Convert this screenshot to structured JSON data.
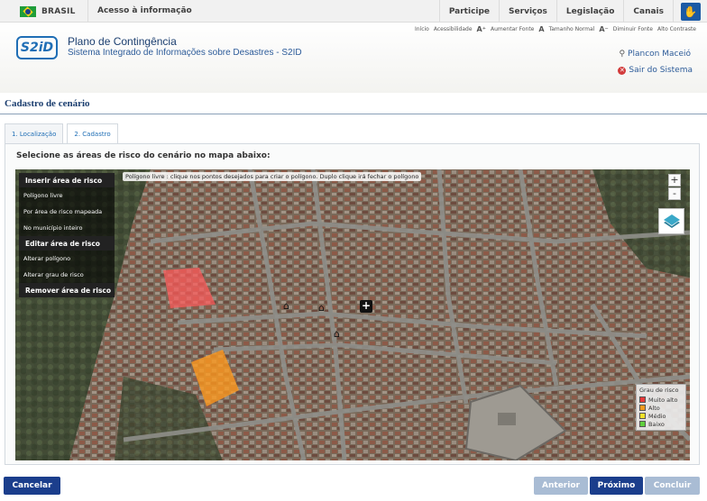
{
  "gov_bar": {
    "brasil": "BRASIL",
    "info": "Acesso à informação",
    "links": [
      "Participe",
      "Serviços",
      "Legislação",
      "Canais"
    ]
  },
  "header": {
    "logo": "S2iD",
    "title": "Plano de Contingência",
    "subtitle": "Sistema Integrado de Informações sobre Desastres - S2ID",
    "access_links": {
      "inicio": "Início",
      "acessibilidade": "Acessibilidade",
      "aumentar": "Aumentar Fonte",
      "normal": "Tamanho Normal",
      "diminuir": "Diminuir Fonte",
      "contraste": "Alto Contraste"
    },
    "user": "Plancon Maceió",
    "logout": "Sair do Sistema"
  },
  "page": {
    "heading": "Cadastro de cenário",
    "tabs": [
      {
        "label": "1. Localização",
        "active": false
      },
      {
        "label": "2. Cadastro",
        "active": true
      }
    ],
    "instruction": "Selecione as áreas de risco do cenário no mapa abaixo:"
  },
  "map": {
    "hint": "Polígono livre : clique nos pontos desejados para criar o polígono. Duplo clique irá fechar o polígono",
    "zoom_in": "+",
    "zoom_out": "-",
    "menu": {
      "insert_header": "Inserir área de risco",
      "insert_items": [
        "Polígono livre",
        "Por área de risco mapeada",
        "No município inteiro"
      ],
      "edit_header": "Editar área de risco",
      "edit_items": [
        "Alterar polígono",
        "Alterar grau de risco"
      ],
      "remove_header": "Remover área de risco"
    },
    "legend": {
      "title": "Grau de risco",
      "items": [
        {
          "label": "Muito alto",
          "color": "#e83a3a"
        },
        {
          "label": "Alto",
          "color": "#f39a1e"
        },
        {
          "label": "Médio",
          "color": "#f1e12a"
        },
        {
          "label": "Baixo",
          "color": "#5fcf3d"
        }
      ]
    },
    "risk_areas": [
      {
        "level": "Muito alto",
        "color": "#ff5a5a"
      },
      {
        "level": "Alto",
        "color": "#ff9a1e"
      }
    ],
    "markers": [
      "school-icon",
      "school-icon",
      "school-icon",
      "health-post-icon"
    ]
  },
  "buttons": {
    "cancel": "Cancelar",
    "previous": "Anterior",
    "next": "Próximo",
    "finish": "Concluir"
  }
}
